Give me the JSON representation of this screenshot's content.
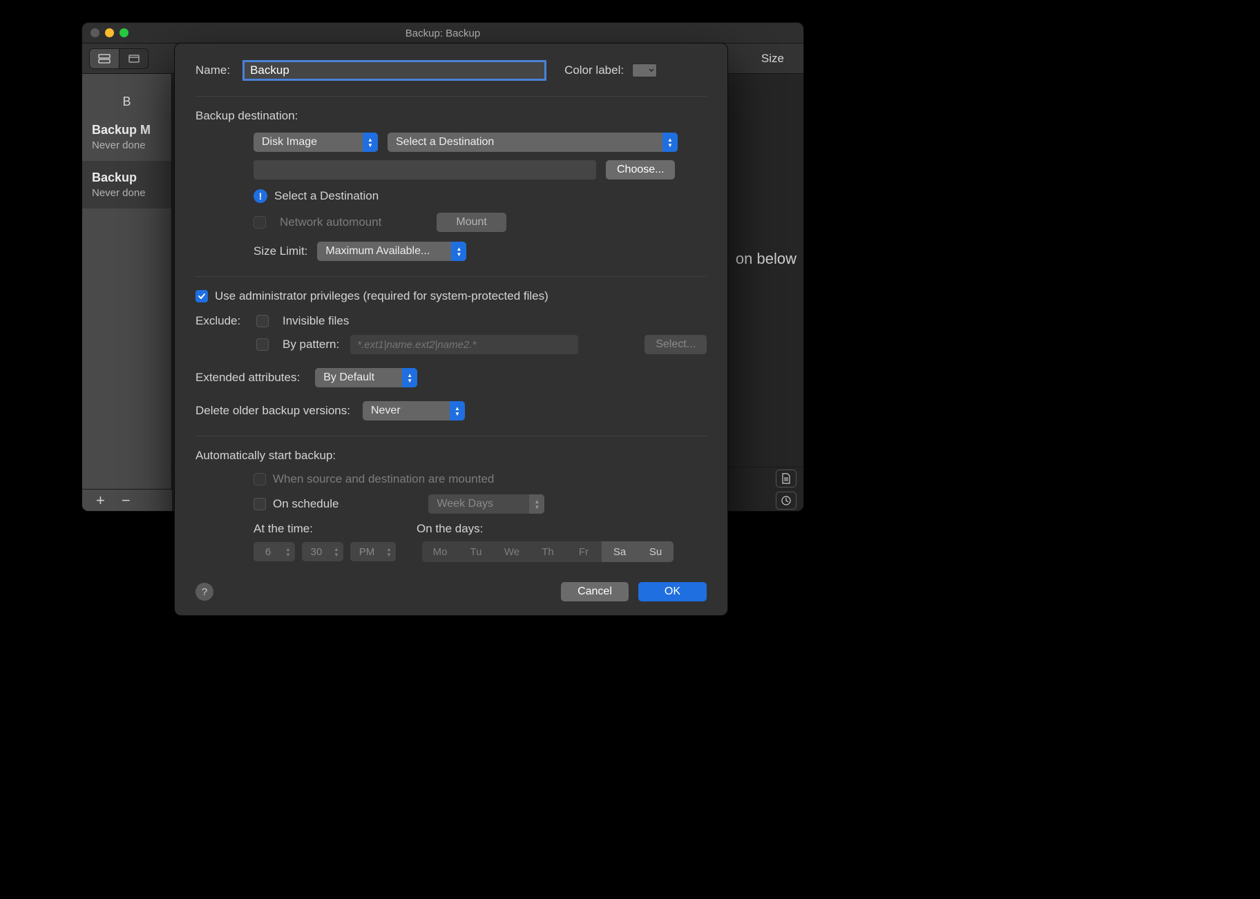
{
  "main_window": {
    "title": "Backup: Backup",
    "size_header": "Size",
    "side_header_letter": "B",
    "sidebar": [
      {
        "title": "Backup M",
        "subtitle": "Never done"
      },
      {
        "title": "Backup",
        "subtitle": "Never done"
      }
    ],
    "content_peek": "on below",
    "footer_plus": "+",
    "footer_minus": "−"
  },
  "dialog": {
    "name_label": "Name:",
    "name_value": "Backup",
    "color_label": "Color label:",
    "dest_section": "Backup destination:",
    "dest_type": "Disk Image",
    "dest_target": "Select a Destination",
    "choose": "Choose...",
    "dest_info": "Select a Destination",
    "net_automount": "Network automount",
    "mount": "Mount",
    "size_limit_label": "Size Limit:",
    "size_limit_value": "Maximum Available...",
    "admin_priv": "Use administrator privileges (required for system-protected files)",
    "exclude_label": "Exclude:",
    "exclude_invisible": "Invisible files",
    "exclude_by_pattern": "By pattern:",
    "pattern_placeholder": "*.ext1|name.ext2|name2.*",
    "select_btn": "Select...",
    "ext_attr_label": "Extended attributes:",
    "ext_attr_value": "By Default",
    "del_older_label": "Delete older backup versions:",
    "del_older_value": "Never",
    "auto_section": "Automatically start backup:",
    "auto_when_mounted": "When source and destination are mounted",
    "auto_on_schedule": "On schedule",
    "schedule_select": "Week Days",
    "at_time_label": "At the time:",
    "on_days_label": "On the days:",
    "time_hour": "6",
    "time_min": "30",
    "time_ampm": "PM",
    "days": [
      "Mo",
      "Tu",
      "We",
      "Th",
      "Fr",
      "Sa",
      "Su"
    ],
    "help": "?",
    "cancel": "Cancel",
    "ok": "OK"
  }
}
